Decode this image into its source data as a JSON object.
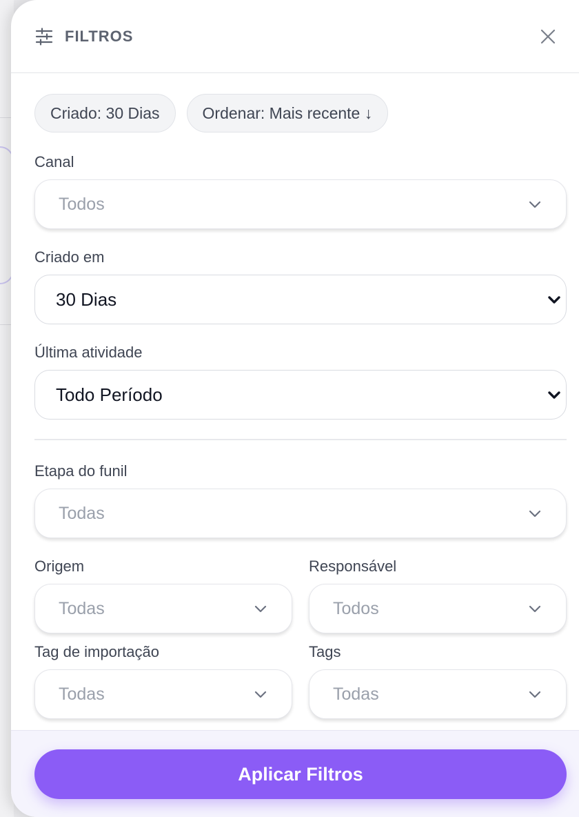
{
  "header": {
    "title": "FILTROS"
  },
  "chips": [
    {
      "label": "Criado: 30 Dias"
    },
    {
      "label": "Ordenar: Mais recente ↓"
    }
  ],
  "canal": {
    "label": "Canal",
    "value": "Todos"
  },
  "criado_em": {
    "label": "Criado em",
    "value": "30 Dias"
  },
  "ultima_atividade": {
    "label": "Última atividade",
    "value": "Todo Período"
  },
  "etapa_funil": {
    "label": "Etapa do funil",
    "value": "Todas"
  },
  "origem": {
    "label": "Origem",
    "value": "Todas"
  },
  "responsavel": {
    "label": "Responsável",
    "value": "Todos"
  },
  "tag_importacao": {
    "label": "Tag de importação",
    "value": "Todas"
  },
  "tags": {
    "label": "Tags",
    "value": "Todas"
  },
  "footer": {
    "apply_label": "Aplicar Filtros"
  },
  "colors": {
    "accent": "#8b5cf6",
    "placeholder": "#9aa0ab",
    "text": "#3f4553"
  },
  "icons": {
    "header": "sliders-icon",
    "close": "close-icon",
    "dropdown": "chevron-down-icon"
  }
}
